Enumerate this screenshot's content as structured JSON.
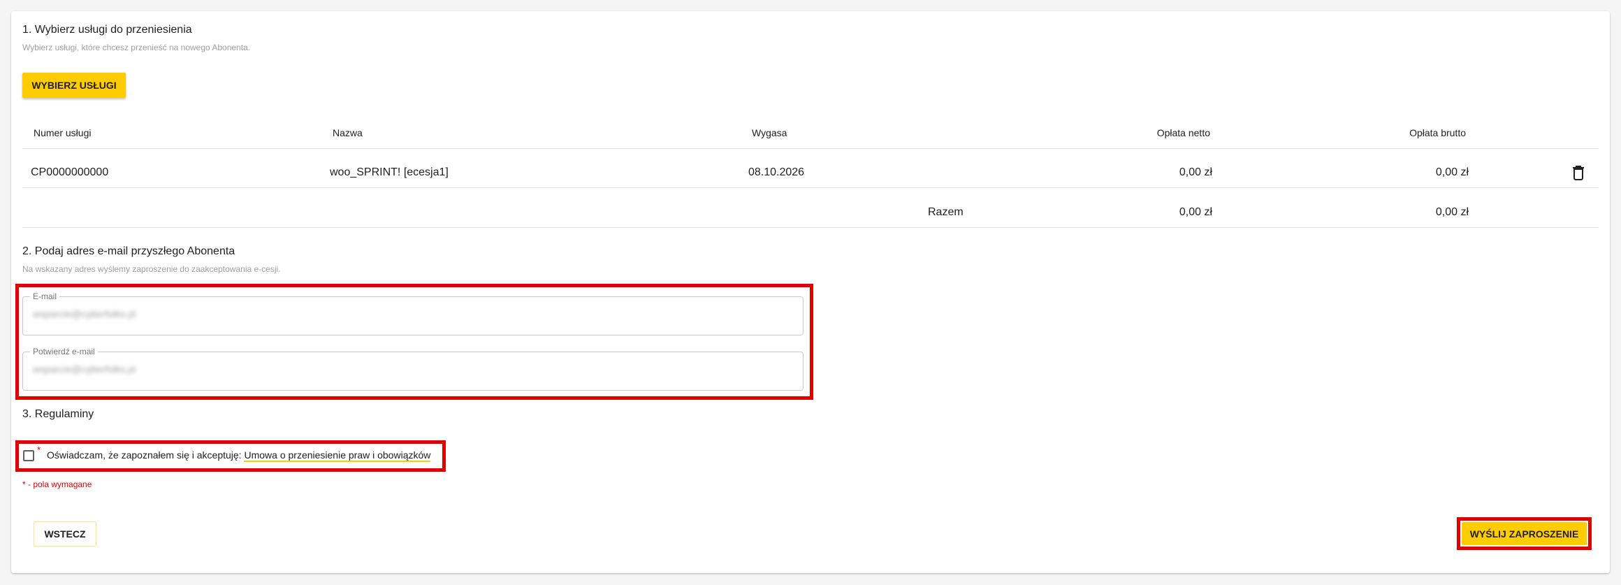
{
  "section1": {
    "title": "1. Wybierz usługi do przeniesienia",
    "subtitle": "Wybierz usługi, które chcesz przenieść na nowego Abonenta.",
    "select_button": "WYBIERZ USŁUGI"
  },
  "table": {
    "headers": [
      "Numer usługi",
      "Nazwa",
      "Wygasa",
      "Opłata netto",
      "Opłata brutto"
    ],
    "rows": [
      {
        "number": "CP0000000000",
        "name": "woo_SPRINT! [ecesja1]",
        "expires": "08.10.2026",
        "net": "0,00 zł",
        "gross": "0,00 zł",
        "action_icon": "trash-icon"
      }
    ],
    "total": {
      "label": "Razem",
      "net": "0,00 zł",
      "gross": "0,00 zł"
    }
  },
  "section2": {
    "title": "2. Podaj adres e-mail przyszłego Abonenta",
    "subtitle": "Na wskazany adres wyślemy zaproszenie do zaakceptowania e-cesji.",
    "email_label": "E-mail",
    "email_value": "wsparcie@cyberfolks.pl",
    "confirm_label": "Potwierdź e-mail",
    "confirm_value": "wsparcie@cyberfolks.pl"
  },
  "section3": {
    "title": "3. Regulaminy",
    "asterisk": "*",
    "consent_text": "Oświadczam, że zapoznałem się i akceptuję:",
    "consent_link": "Umowa o przeniesienie praw i obowiązków",
    "required_note": "* - pola wymagane"
  },
  "footer": {
    "back_button": "WSTECZ",
    "send_button": "WYŚLIJ ZAPROSZENIE"
  },
  "colors": {
    "accent": "#ffcc00",
    "highlight": "#e00000"
  }
}
